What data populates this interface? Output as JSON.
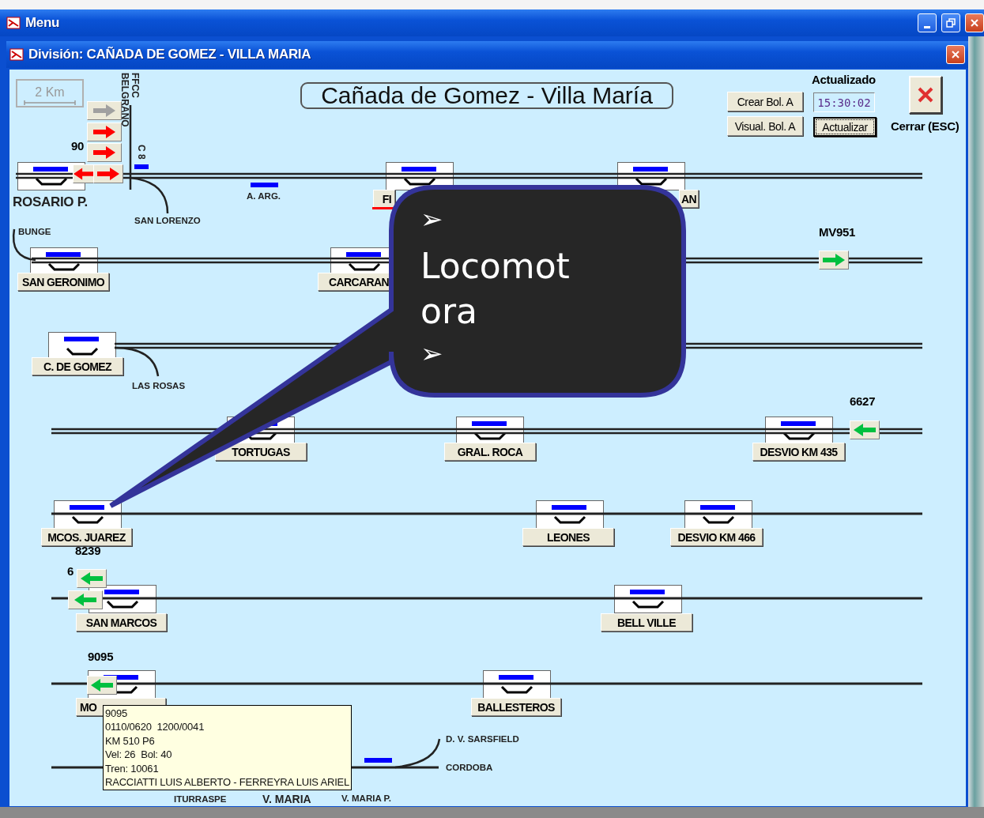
{
  "window": {
    "title": "Menu"
  },
  "child_window": {
    "title": "División: CAÑADA DE GOMEZ - VILLA MARIA"
  },
  "scale": {
    "label": "2 Km"
  },
  "section_title": "Cañada de Gomez - Villa María",
  "toolbar": {
    "buttons": [
      {
        "label": "Crear Bol. A"
      },
      {
        "label": "Visual. Bol. A"
      }
    ],
    "updated_label": "Actualizado",
    "time": "15:30:02",
    "refresh_button": {
      "label": "Actualizar",
      "focused": true
    },
    "close_label": "Cerrar (ESC)"
  },
  "stations": [
    {
      "name": "ROSARIO P.",
      "kind": "terminal"
    },
    {
      "name": "FI",
      "kind": "station"
    },
    {
      "name": "AN",
      "kind": "station"
    },
    {
      "name": "SAN GERONIMO",
      "kind": "station"
    },
    {
      "name": "CARCARAN",
      "kind": "station"
    },
    {
      "name": "C. DE GOMEZ",
      "kind": "station"
    },
    {
      "name": "TORTUGAS",
      "kind": "station"
    },
    {
      "name": "GRAL. ROCA",
      "kind": "station"
    },
    {
      "name": "DESVIO KM 435",
      "kind": "station"
    },
    {
      "name": "MCOS. JUAREZ",
      "kind": "station"
    },
    {
      "name": "LEONES",
      "kind": "station"
    },
    {
      "name": "DESVIO KM 466",
      "kind": "station"
    },
    {
      "name": "SAN MARCOS",
      "kind": "station"
    },
    {
      "name": "BELL VILLE",
      "kind": "station"
    },
    {
      "name": "MO",
      "kind": "station"
    },
    {
      "name": "BALLESTEROS",
      "kind": "station"
    }
  ],
  "labels": [
    {
      "text": "90",
      "kind": "train_number"
    },
    {
      "text": "FFCC",
      "kind": "vertical"
    },
    {
      "text": "BELGRANO",
      "kind": "vertical"
    },
    {
      "text": "C 8",
      "kind": "vertical"
    },
    {
      "text": "A. ARG.",
      "kind": "place"
    },
    {
      "text": "SAN LORENZO",
      "kind": "place"
    },
    {
      "text": "BUNGE",
      "kind": "place"
    },
    {
      "text": "MV951",
      "kind": "train_number"
    },
    {
      "text": "LAS ROSAS",
      "kind": "place"
    },
    {
      "text": "6627",
      "kind": "train_number"
    },
    {
      "text": "8239",
      "kind": "train_number"
    },
    {
      "text": "6",
      "kind": "train_number"
    },
    {
      "text": "9095",
      "kind": "train_number"
    },
    {
      "text": "D. V. SARSFIELD",
      "kind": "place"
    },
    {
      "text": "CORDOBA",
      "kind": "place"
    },
    {
      "text": "ITURRASPE",
      "kind": "place"
    },
    {
      "text": "V. MARIA",
      "kind": "big"
    },
    {
      "text": "V. MARIA P.",
      "kind": "place"
    }
  ],
  "trains": [
    {
      "kind": "right",
      "color": "#a0a0a0"
    },
    {
      "kind": "right",
      "color": "#ff0000"
    },
    {
      "kind": "right",
      "color": "#ff0000"
    },
    {
      "kind": "left",
      "color": "#ff0000"
    },
    {
      "kind": "right",
      "color": "#ff0000"
    },
    {
      "kind": "right",
      "color": "#00c040"
    },
    {
      "kind": "left",
      "color": "#00c040"
    },
    {
      "kind": "left",
      "color": "#00c040"
    },
    {
      "kind": "left",
      "color": "#00c040"
    },
    {
      "kind": "left",
      "color": "#00c040"
    }
  ],
  "callout": {
    "lines": [
      "➢",
      "Locomotora",
      "➢"
    ]
  },
  "tooltip": {
    "lines": [
      "9095",
      "0110/0620  1200/0041",
      "KM 510 P6",
      "Vel: 26  Bol: 40",
      "Tren: 10061",
      "RACCIATTI LUIS ALBERTO - FERREYRA LUIS ARIEL"
    ]
  }
}
